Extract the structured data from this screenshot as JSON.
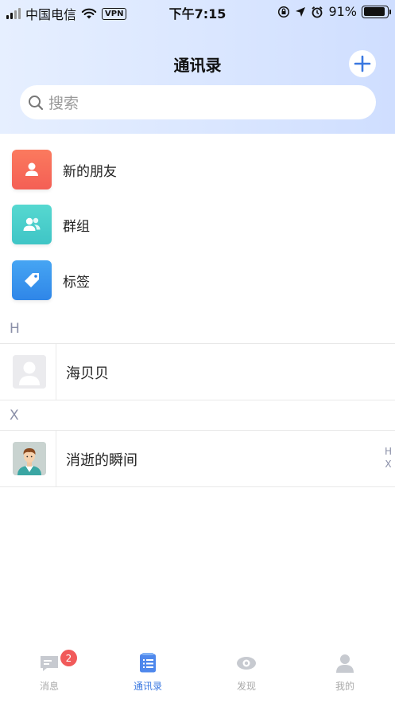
{
  "status_bar": {
    "carrier": "中国电信",
    "vpn": "VPN",
    "time": "下午7:15",
    "battery": "91%",
    "battery_level": 0.91
  },
  "header": {
    "title": "通讯录",
    "search_placeholder": "搜索"
  },
  "functions": [
    {
      "label": "新的朋友",
      "icon": "person-icon",
      "color": "#f86e58"
    },
    {
      "label": "群组",
      "icon": "group-icon",
      "color": "#47cfc9"
    },
    {
      "label": "标签",
      "icon": "tag-icon",
      "color": "#3a94ee"
    }
  ],
  "sections": [
    {
      "letter": "H",
      "contacts": [
        {
          "name": "海贝贝",
          "avatar": "default-avatar"
        }
      ]
    },
    {
      "letter": "X",
      "contacts": [
        {
          "name": "消逝的瞬间",
          "avatar": "cartoon-avatar"
        }
      ]
    }
  ],
  "index_bar": [
    "H",
    "X"
  ],
  "tabs": [
    {
      "label": "消息",
      "icon": "message-icon",
      "badge": "2",
      "active": false
    },
    {
      "label": "通讯录",
      "icon": "contacts-icon",
      "active": true
    },
    {
      "label": "发现",
      "icon": "eye-icon",
      "active": false
    },
    {
      "label": "我的",
      "icon": "profile-icon",
      "active": false
    }
  ],
  "colors": {
    "accent": "#3a78e0",
    "badge": "#f15a5a",
    "section_letter": "#8a8fa8"
  }
}
